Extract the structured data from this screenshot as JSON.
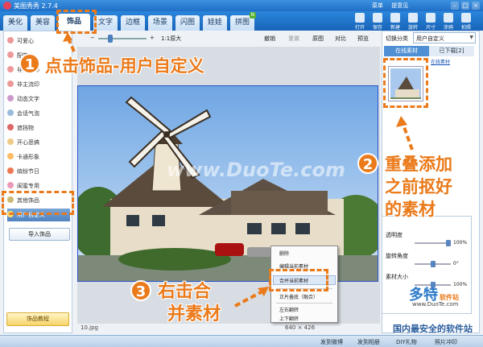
{
  "app": {
    "title": "美图秀秀 2.7.4",
    "title_links": [
      "菜单",
      "提意见"
    ]
  },
  "tabs": [
    {
      "label": "美化"
    },
    {
      "label": "美容"
    },
    {
      "label": "饰品"
    },
    {
      "label": "文字"
    },
    {
      "label": "边框"
    },
    {
      "label": "场景"
    },
    {
      "label": "闪图"
    },
    {
      "label": "娃娃"
    },
    {
      "label": "拼图"
    }
  ],
  "toolbar": [
    {
      "label": "打开"
    },
    {
      "label": "保存"
    },
    {
      "label": "新建"
    },
    {
      "label": "旋转"
    },
    {
      "label": "尺寸"
    },
    {
      "label": "涂鸦"
    },
    {
      "label": "拍照"
    }
  ],
  "sidebar": {
    "items": [
      {
        "label": "可爱心"
      },
      {
        "label": "配饰"
      },
      {
        "label": "非主流印"
      },
      {
        "label": "非主流印"
      },
      {
        "label": "动态文字"
      },
      {
        "label": "会话气泡"
      },
      {
        "label": "遮挡物"
      },
      {
        "label": "开心恶搞"
      },
      {
        "label": "卡通形象"
      },
      {
        "label": "缤纷节日"
      },
      {
        "label": "闺蜜专用"
      },
      {
        "label": "其他饰品"
      },
      {
        "label": "用户自定义"
      }
    ],
    "import_label": "导入饰品",
    "tutorial_label": "饰品教程"
  },
  "canvas_controls": {
    "zoom_ratio": "1:1原大",
    "undo": "撤销",
    "redo": "重做",
    "original": "原图",
    "compare": "对比",
    "preview": "预览"
  },
  "status": {
    "filename": "10.jpg",
    "dimensions": "640 × 426"
  },
  "right_panel": {
    "category_label": "切换分类",
    "category_value": "用户自定义",
    "tab_online": "在线素材",
    "tab_downloaded": "已下载[2]",
    "link_label": "在线素材"
  },
  "props": {
    "opacity_label": "透明度",
    "opacity_value": "100%",
    "rotate_label": "旋转角度",
    "rotate_value": "0°",
    "size_label": "素材大小",
    "size_value": "100%"
  },
  "context_menu": {
    "items": [
      "删除",
      "编辑当前素材",
      "合并当前素材",
      "正片叠底（融合）",
      "左右翻转",
      "上下翻转"
    ]
  },
  "annotations": {
    "step1": "点击饰品-用户自定义",
    "step2_line1": "重叠添加",
    "step2_line2": "之前抠好",
    "step2_line3": "的素材",
    "step3_line1": "右击合",
    "step3_line2": "并素材",
    "num1": "1",
    "num2": "2",
    "num3": "3"
  },
  "watermark": {
    "center": "www.DuoTe.com",
    "brand": "多特",
    "brand_sub": "软件站",
    "url": "www.DuoTe.com",
    "slogan": "国内最安全的软件站"
  },
  "bottom_bar": [
    "发到微博",
    "发到相册",
    "DIY礼物",
    "照片冲印"
  ],
  "colors": {
    "accent": "#ea7a1a",
    "title_blue": "#1f6fc6"
  }
}
